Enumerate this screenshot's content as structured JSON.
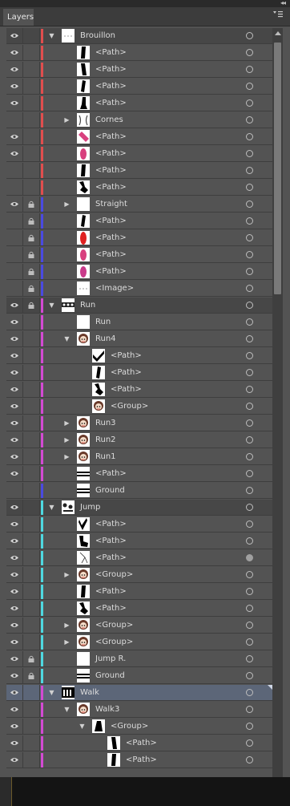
{
  "panel": {
    "tab_label": "Layers",
    "collapse_glyph": "◂◂",
    "close_glyph": "✕",
    "menu_glyph": "▾☰"
  },
  "colors": {
    "red": "#e04e4e",
    "blue": "#4a4ae0",
    "magenta": "#d34ad3",
    "cyan": "#4fd8e0"
  },
  "rows": [
    {
      "label": "Brouillon",
      "eye": true,
      "lock": false,
      "color": "red",
      "indent": 0,
      "twirl": "open",
      "layer": true,
      "thumb": "dots"
    },
    {
      "label": "<Path>",
      "eye": true,
      "lock": false,
      "color": "red",
      "indent": 1,
      "twirl": "",
      "thumb": "black-leg"
    },
    {
      "label": "<Path>",
      "eye": true,
      "lock": false,
      "color": "red",
      "indent": 1,
      "twirl": "",
      "thumb": "black-leg2"
    },
    {
      "label": "<Path>",
      "eye": true,
      "lock": false,
      "color": "red",
      "indent": 1,
      "twirl": "",
      "thumb": "black-leg3"
    },
    {
      "label": "<Path>",
      "eye": true,
      "lock": false,
      "color": "red",
      "indent": 1,
      "twirl": "",
      "thumb": "black-foot"
    },
    {
      "label": "Cornes",
      "eye": false,
      "lock": false,
      "color": "red",
      "indent": 1,
      "twirl": "closed",
      "thumb": "horns"
    },
    {
      "label": "<Path>",
      "eye": true,
      "lock": false,
      "color": "red",
      "indent": 1,
      "twirl": "",
      "thumb": "pink-diag"
    },
    {
      "label": "<Path>",
      "eye": true,
      "lock": false,
      "color": "red",
      "indent": 1,
      "twirl": "",
      "thumb": "pink-oval"
    },
    {
      "label": "<Path>",
      "eye": false,
      "lock": false,
      "color": "red",
      "indent": 1,
      "twirl": "",
      "thumb": "black-leg"
    },
    {
      "label": "<Path>",
      "eye": false,
      "lock": false,
      "color": "red",
      "indent": 1,
      "twirl": "",
      "thumb": "black-boot"
    },
    {
      "label": "Straight",
      "eye": true,
      "lock": true,
      "color": "blue",
      "indent": 1,
      "twirl": "closed",
      "thumb": "blank"
    },
    {
      "label": "<Path>",
      "eye": false,
      "lock": true,
      "color": "blue",
      "indent": 1,
      "twirl": "",
      "thumb": "black-leg3"
    },
    {
      "label": "<Path>",
      "eye": false,
      "lock": true,
      "color": "blue",
      "indent": 1,
      "twirl": "",
      "thumb": "red-leg"
    },
    {
      "label": "<Path>",
      "eye": false,
      "lock": true,
      "color": "blue",
      "indent": 1,
      "twirl": "",
      "thumb": "pink-oval"
    },
    {
      "label": "<Path>",
      "eye": false,
      "lock": true,
      "color": "blue",
      "indent": 1,
      "twirl": "",
      "thumb": "pink-oval2"
    },
    {
      "label": "<Image>",
      "eye": false,
      "lock": true,
      "color": "blue",
      "indent": 1,
      "twirl": "",
      "thumb": "dots"
    },
    {
      "label": "Run",
      "eye": true,
      "lock": true,
      "color": "magenta",
      "indent": 0,
      "twirl": "open",
      "layer": true,
      "thumb": "strip"
    },
    {
      "label": "Run",
      "eye": true,
      "lock": false,
      "color": "magenta",
      "indent": 1,
      "twirl": "",
      "thumb": "blank"
    },
    {
      "label": "Run4",
      "eye": true,
      "lock": false,
      "color": "magenta",
      "indent": 1,
      "twirl": "open",
      "thumb": "face"
    },
    {
      "label": "<Path>",
      "eye": true,
      "lock": false,
      "color": "magenta",
      "indent": 2,
      "twirl": "",
      "thumb": "check"
    },
    {
      "label": "<Path>",
      "eye": true,
      "lock": false,
      "color": "magenta",
      "indent": 2,
      "twirl": "",
      "thumb": "black-leg3"
    },
    {
      "label": "<Path>",
      "eye": true,
      "lock": false,
      "color": "magenta",
      "indent": 2,
      "twirl": "",
      "thumb": "black-boot"
    },
    {
      "label": "<Group>",
      "eye": true,
      "lock": false,
      "color": "magenta",
      "indent": 2,
      "twirl": "",
      "thumb": "face"
    },
    {
      "label": "Run3",
      "eye": true,
      "lock": false,
      "color": "magenta",
      "indent": 1,
      "twirl": "closed",
      "thumb": "face"
    },
    {
      "label": "Run2",
      "eye": true,
      "lock": false,
      "color": "magenta",
      "indent": 1,
      "twirl": "closed",
      "thumb": "face"
    },
    {
      "label": "Run1",
      "eye": true,
      "lock": false,
      "color": "magenta",
      "indent": 1,
      "twirl": "closed",
      "thumb": "face"
    },
    {
      "label": "<Path>",
      "eye": true,
      "lock": false,
      "color": "magenta",
      "indent": 1,
      "twirl": "",
      "thumb": "ground"
    },
    {
      "label": "Ground",
      "eye": false,
      "lock": false,
      "color": "blue",
      "indent": 1,
      "twirl": "",
      "thumb": "ground"
    },
    {
      "label": "Jump",
      "eye": true,
      "lock": false,
      "color": "cyan",
      "indent": 0,
      "twirl": "open",
      "layer": true,
      "thumb": "strip2"
    },
    {
      "label": "<Path>",
      "eye": true,
      "lock": false,
      "color": "cyan",
      "indent": 1,
      "twirl": "",
      "thumb": "check2"
    },
    {
      "label": "<Path>",
      "eye": true,
      "lock": false,
      "color": "cyan",
      "indent": 1,
      "twirl": "",
      "thumb": "black-boot2"
    },
    {
      "label": "<Path>",
      "eye": true,
      "lock": false,
      "color": "cyan",
      "indent": 1,
      "twirl": "",
      "thumb": "outline",
      "target_filled": true
    },
    {
      "label": "<Group>",
      "eye": true,
      "lock": false,
      "color": "cyan",
      "indent": 1,
      "twirl": "closed",
      "thumb": "face"
    },
    {
      "label": "<Path>",
      "eye": true,
      "lock": false,
      "color": "cyan",
      "indent": 1,
      "twirl": "",
      "thumb": "black-leg"
    },
    {
      "label": "<Path>",
      "eye": true,
      "lock": false,
      "color": "cyan",
      "indent": 1,
      "twirl": "",
      "thumb": "black-boot"
    },
    {
      "label": "<Group>",
      "eye": true,
      "lock": false,
      "color": "cyan",
      "indent": 1,
      "twirl": "closed",
      "thumb": "face"
    },
    {
      "label": "<Group>",
      "eye": true,
      "lock": false,
      "color": "cyan",
      "indent": 1,
      "twirl": "closed",
      "thumb": "face"
    },
    {
      "label": "Jump R.",
      "eye": true,
      "lock": true,
      "color": "cyan",
      "indent": 1,
      "twirl": "",
      "thumb": "blank"
    },
    {
      "label": "Ground",
      "eye": true,
      "lock": true,
      "color": "cyan",
      "indent": 1,
      "twirl": "",
      "thumb": "ground"
    },
    {
      "label": "Walk",
      "eye": true,
      "lock": false,
      "color": "magenta",
      "indent": 0,
      "twirl": "open",
      "layer": true,
      "selected": true,
      "thumb": "strip3"
    },
    {
      "label": "Walk3",
      "eye": true,
      "lock": false,
      "color": "magenta",
      "indent": 1,
      "twirl": "open",
      "thumb": "face"
    },
    {
      "label": "<Group>",
      "eye": true,
      "lock": false,
      "color": "magenta",
      "indent": 2,
      "twirl": "open",
      "thumb": "black-fig"
    },
    {
      "label": "<Path>",
      "eye": true,
      "lock": false,
      "color": "magenta",
      "indent": 3,
      "twirl": "",
      "thumb": "black-leg2"
    },
    {
      "label": "<Path>",
      "eye": true,
      "lock": false,
      "color": "magenta",
      "indent": 3,
      "twirl": "",
      "thumb": "black-leg"
    }
  ]
}
